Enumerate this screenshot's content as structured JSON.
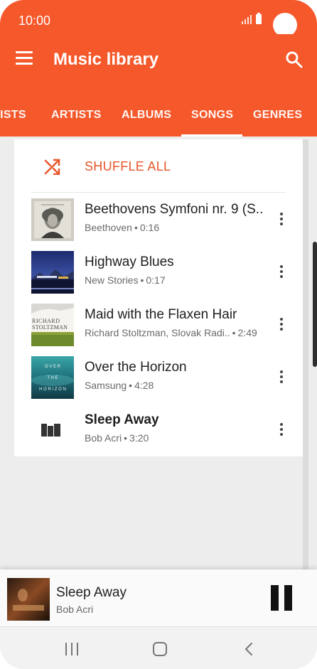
{
  "status_bar": {
    "time": "10:00"
  },
  "app_bar": {
    "title": "Music library"
  },
  "tabs": [
    {
      "label": "LISTS"
    },
    {
      "label": "ARTISTS"
    },
    {
      "label": "ALBUMS"
    },
    {
      "label": "SONGS",
      "selected": true
    },
    {
      "label": "GENRES"
    }
  ],
  "shuffle": {
    "label": "SHUFFLE ALL"
  },
  "songs": [
    {
      "title": "Beethovens Symfoni nr. 9 (S..",
      "artist": "Beethoven",
      "duration": "0:16",
      "art": "beethoven-portrait"
    },
    {
      "title": "Highway Blues",
      "artist": "New Stories",
      "duration": "0:17",
      "art": "highway-blues-cover"
    },
    {
      "title": "Maid with the Flaxen Hair",
      "artist": "Richard Stoltzman, Slovak Radi..",
      "duration": "2:49",
      "art": "richard-stoltzman-cover"
    },
    {
      "title": "Over the Horizon",
      "artist": "Samsung",
      "duration": "4:28",
      "art": "over-the-horizon-cover"
    },
    {
      "title": "Sleep Away",
      "artist": "Bob Acri",
      "duration": "3:20",
      "art": "now-playing-bars",
      "playing": true
    }
  ],
  "cover_text": {
    "richard": "RICHARD",
    "stoltzman": "STOLTZMAN",
    "over": "O V E R",
    "the": "T H E",
    "horizon": "H O R I Z O N"
  },
  "player": {
    "title": "Sleep Away",
    "artist": "Bob Acri"
  },
  "separator": "•",
  "colors": {
    "accent": "#f5582a",
    "shuffle_text": "#e8562a"
  },
  "icons": [
    "menu-icon",
    "search-icon",
    "shuffle-icon",
    "more-vert-icon",
    "pause-icon",
    "recent-apps-icon",
    "home-icon",
    "back-icon"
  ]
}
